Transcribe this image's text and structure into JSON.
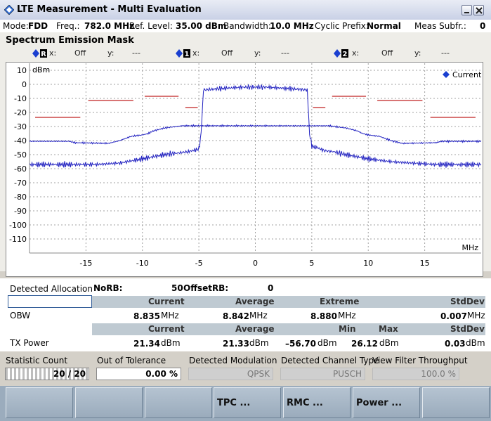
{
  "window": {
    "title": "LTE Measurement  - Multi Evaluation"
  },
  "info": {
    "mode_label": "Mode:",
    "mode": "FDD",
    "freq_label": "Freq.:",
    "freq": "782.0 MHz",
    "ref_label": "Ref. Level:",
    "ref": "35.00 dBm",
    "bw_label": "Bandwidth:",
    "bw": "10.0 MHz",
    "cp_label": "Cyclic Prefix:",
    "cp": "Normal",
    "subfr_label": "Meas Subfr.:",
    "subfr": "0"
  },
  "panel_title": "Spectrum Emission Mask",
  "markers": [
    {
      "id": "R",
      "x_label": "x:",
      "x": "Off",
      "y_label": "y:",
      "y": "---"
    },
    {
      "id": "1",
      "x_label": "x:",
      "x": "Off",
      "y_label": "y:",
      "y": "---"
    },
    {
      "id": "2",
      "x_label": "x:",
      "x": "Off",
      "y_label": "y:",
      "y": "---"
    }
  ],
  "chart_data": {
    "type": "line",
    "ylabel": "dBm",
    "xlabel": "MHz",
    "xlim": [
      -20,
      20
    ],
    "ylim": [
      -120,
      15
    ],
    "x_ticks": [
      "-15",
      "-10",
      "-5",
      "0",
      "5",
      "10",
      "15"
    ],
    "y_ticks": [
      "10",
      "0",
      "-10",
      "-20",
      "-30",
      "-40",
      "-50",
      "-60",
      "-70",
      "-80",
      "-90",
      "-100",
      "-110"
    ],
    "legend": "Current",
    "grid": true,
    "colors": {
      "trace": "#2020c0",
      "mask": "#c02020",
      "grid": "#a0a0a0"
    },
    "series": [
      {
        "name": "Current",
        "x": [
          -20,
          -18,
          -16,
          -14,
          -12,
          -10,
          -8,
          -7,
          -6,
          -5.5,
          -5,
          -4.8,
          -4.6,
          -3,
          -1,
          0,
          1,
          3,
          4.6,
          4.8,
          5,
          5.5,
          6,
          7,
          8,
          10,
          12,
          14,
          16,
          18,
          20
        ],
        "y": [
          -57,
          -57,
          -57,
          -57,
          -56,
          -53,
          -50,
          -49,
          -48,
          -47,
          -46,
          -35,
          -4,
          -3,
          -2,
          -2,
          -2,
          -3,
          -4,
          -35,
          -44,
          -45,
          -47,
          -48,
          -50,
          -53,
          -55,
          -56,
          -57,
          -57,
          -57
        ]
      },
      {
        "name": "Current (upper trace)",
        "x": [
          -20,
          -16.5,
          -16,
          -13,
          -12,
          -11.5,
          -11,
          -10,
          -9.5,
          -9,
          -8,
          -7,
          -6.5,
          -6,
          6,
          6.5,
          7,
          8,
          9,
          9.5,
          10,
          11,
          11.5,
          12,
          13,
          16,
          16.5,
          20
        ],
        "y": [
          -40.5,
          -40.5,
          -41.5,
          -42,
          -40,
          -38.5,
          -37,
          -36,
          -35,
          -33,
          -31,
          -30,
          -29.5,
          -29.5,
          -29.5,
          -29.5,
          -30,
          -31,
          -33,
          -35,
          -36,
          -37,
          -38.5,
          -40,
          -42,
          -41.5,
          -40.5,
          -40.5
        ]
      }
    ],
    "mask": [
      {
        "x": [
          -19.5,
          -15.5
        ],
        "y": [
          -23.5,
          -23.5
        ]
      },
      {
        "x": [
          -14.8,
          -10.8
        ],
        "y": [
          -11.5,
          -11.5
        ]
      },
      {
        "x": [
          -9.8,
          -6.8
        ],
        "y": [
          -8.5,
          -8.5
        ]
      },
      {
        "x": [
          -6.2,
          -5.1
        ],
        "y": [
          -16.5,
          -16.5
        ]
      },
      {
        "x": [
          5.1,
          6.2
        ],
        "y": [
          -16.5,
          -16.5
        ]
      },
      {
        "x": [
          6.8,
          9.8
        ],
        "y": [
          -8.5,
          -8.5
        ]
      },
      {
        "x": [
          10.8,
          14.8
        ],
        "y": [
          -11.5,
          -11.5
        ]
      },
      {
        "x": [
          15.5,
          19.5
        ],
        "y": [
          -23.5,
          -23.5
        ]
      }
    ]
  },
  "allocation": {
    "label": "Detected Allocation",
    "norb_label": "NoRB:",
    "norb": "50",
    "offset_label": "OffsetRB:",
    "offset": "0"
  },
  "obw": {
    "label": "OBW",
    "headers": [
      "Current",
      "Average",
      "Extreme",
      "StdDev"
    ],
    "values": [
      "8.835",
      "8.842",
      "8.880",
      "0.007"
    ],
    "unit": "MHz"
  },
  "txpower": {
    "label": "TX Power",
    "headers": [
      "Current",
      "Average",
      "Min",
      "Max",
      "StdDev"
    ],
    "values": [
      "21.34",
      "21.33",
      "–56.70",
      "26.12",
      "0.03"
    ],
    "unit": "dBm"
  },
  "stats": {
    "count_label": "Statistic Count",
    "count": "20 / 20",
    "count_progress": 1.0,
    "tol_label": "Out of Tolerance",
    "tol": "0.00 %",
    "mod_label": "Detected Modulation",
    "mod": "QPSK",
    "chan_label": "Detected Channel Type",
    "chan": "PUSCH",
    "filter_label": "View Filter Throughput",
    "filter": "100.0 %"
  },
  "softkeys": [
    "",
    "",
    "",
    "TPC ...",
    "RMC ...",
    "Power ...",
    ""
  ]
}
